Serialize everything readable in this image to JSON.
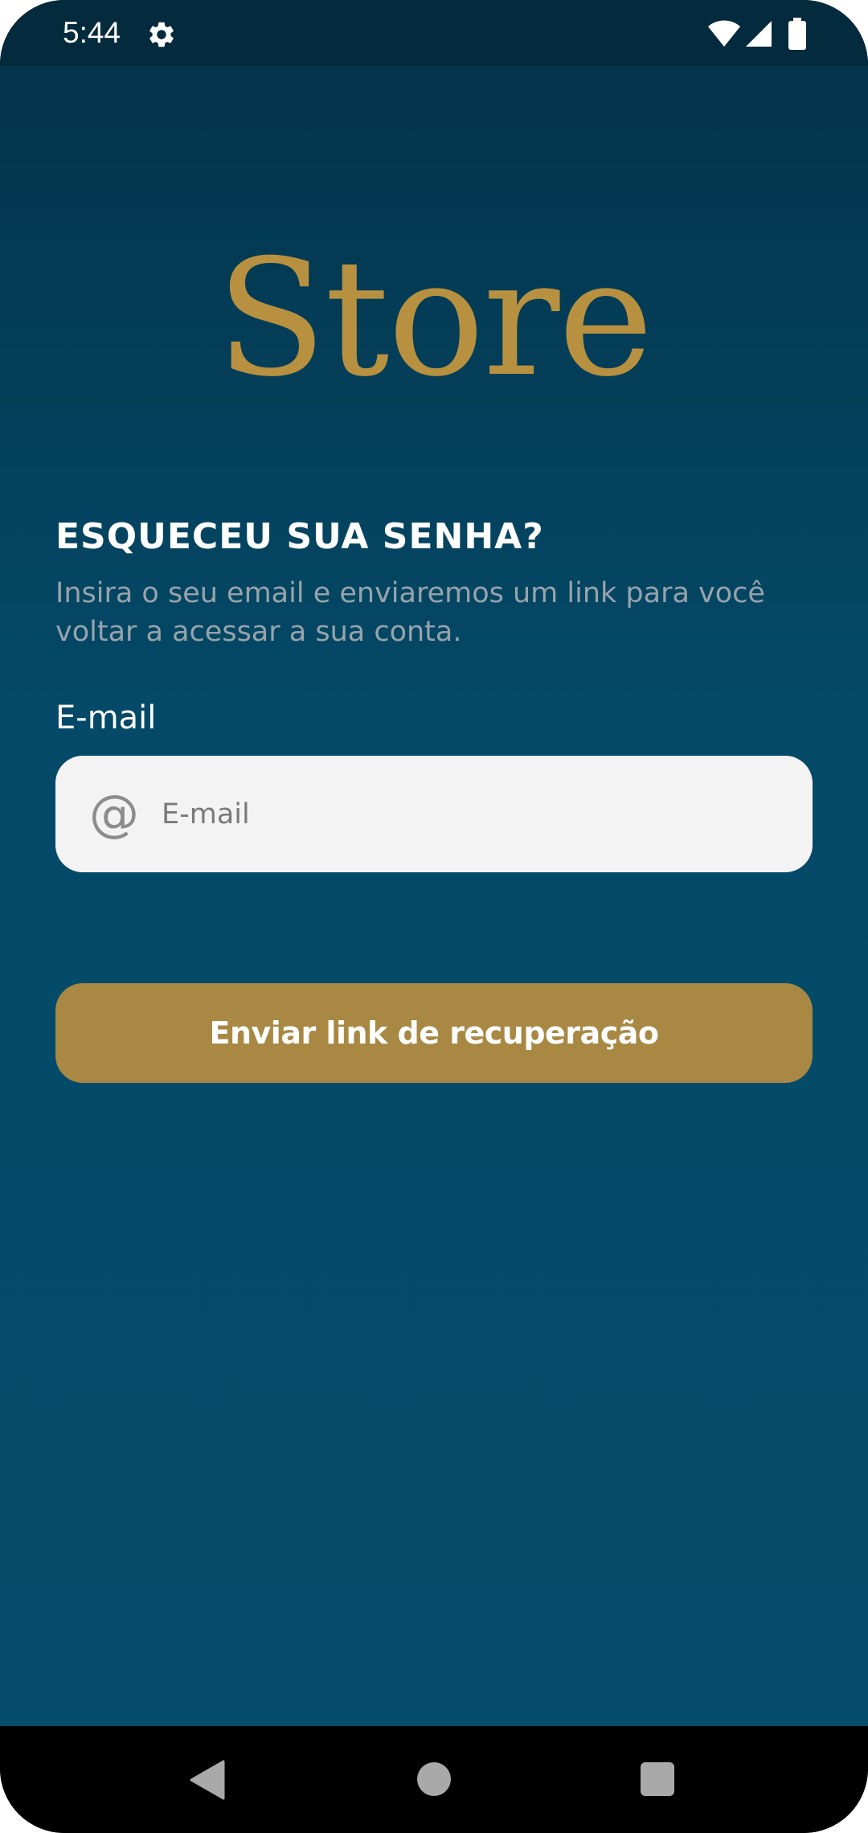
{
  "status_bar": {
    "time": "5:44",
    "icons": [
      "gear-icon",
      "wifi-icon",
      "signal-icon",
      "battery-icon"
    ]
  },
  "brand": {
    "name": "Store",
    "color": "#b89140"
  },
  "forgot_password": {
    "title": "ESQUECEU SUA SENHA?",
    "description": "Insira o seu email e enviaremos um link para você voltar a acessar a sua conta.",
    "email_label": "E-mail",
    "email_placeholder": "E-mail",
    "email_value": "",
    "email_icon": "at-icon",
    "submit_label": "Enviar link de recuperação"
  },
  "colors": {
    "background_top": "#03344c",
    "background_bottom": "#054b6b",
    "accent": "#a88843",
    "input_background": "#f3f3f3"
  },
  "nav_bar": {
    "buttons": [
      "back-icon",
      "home-icon",
      "recents-icon"
    ]
  }
}
